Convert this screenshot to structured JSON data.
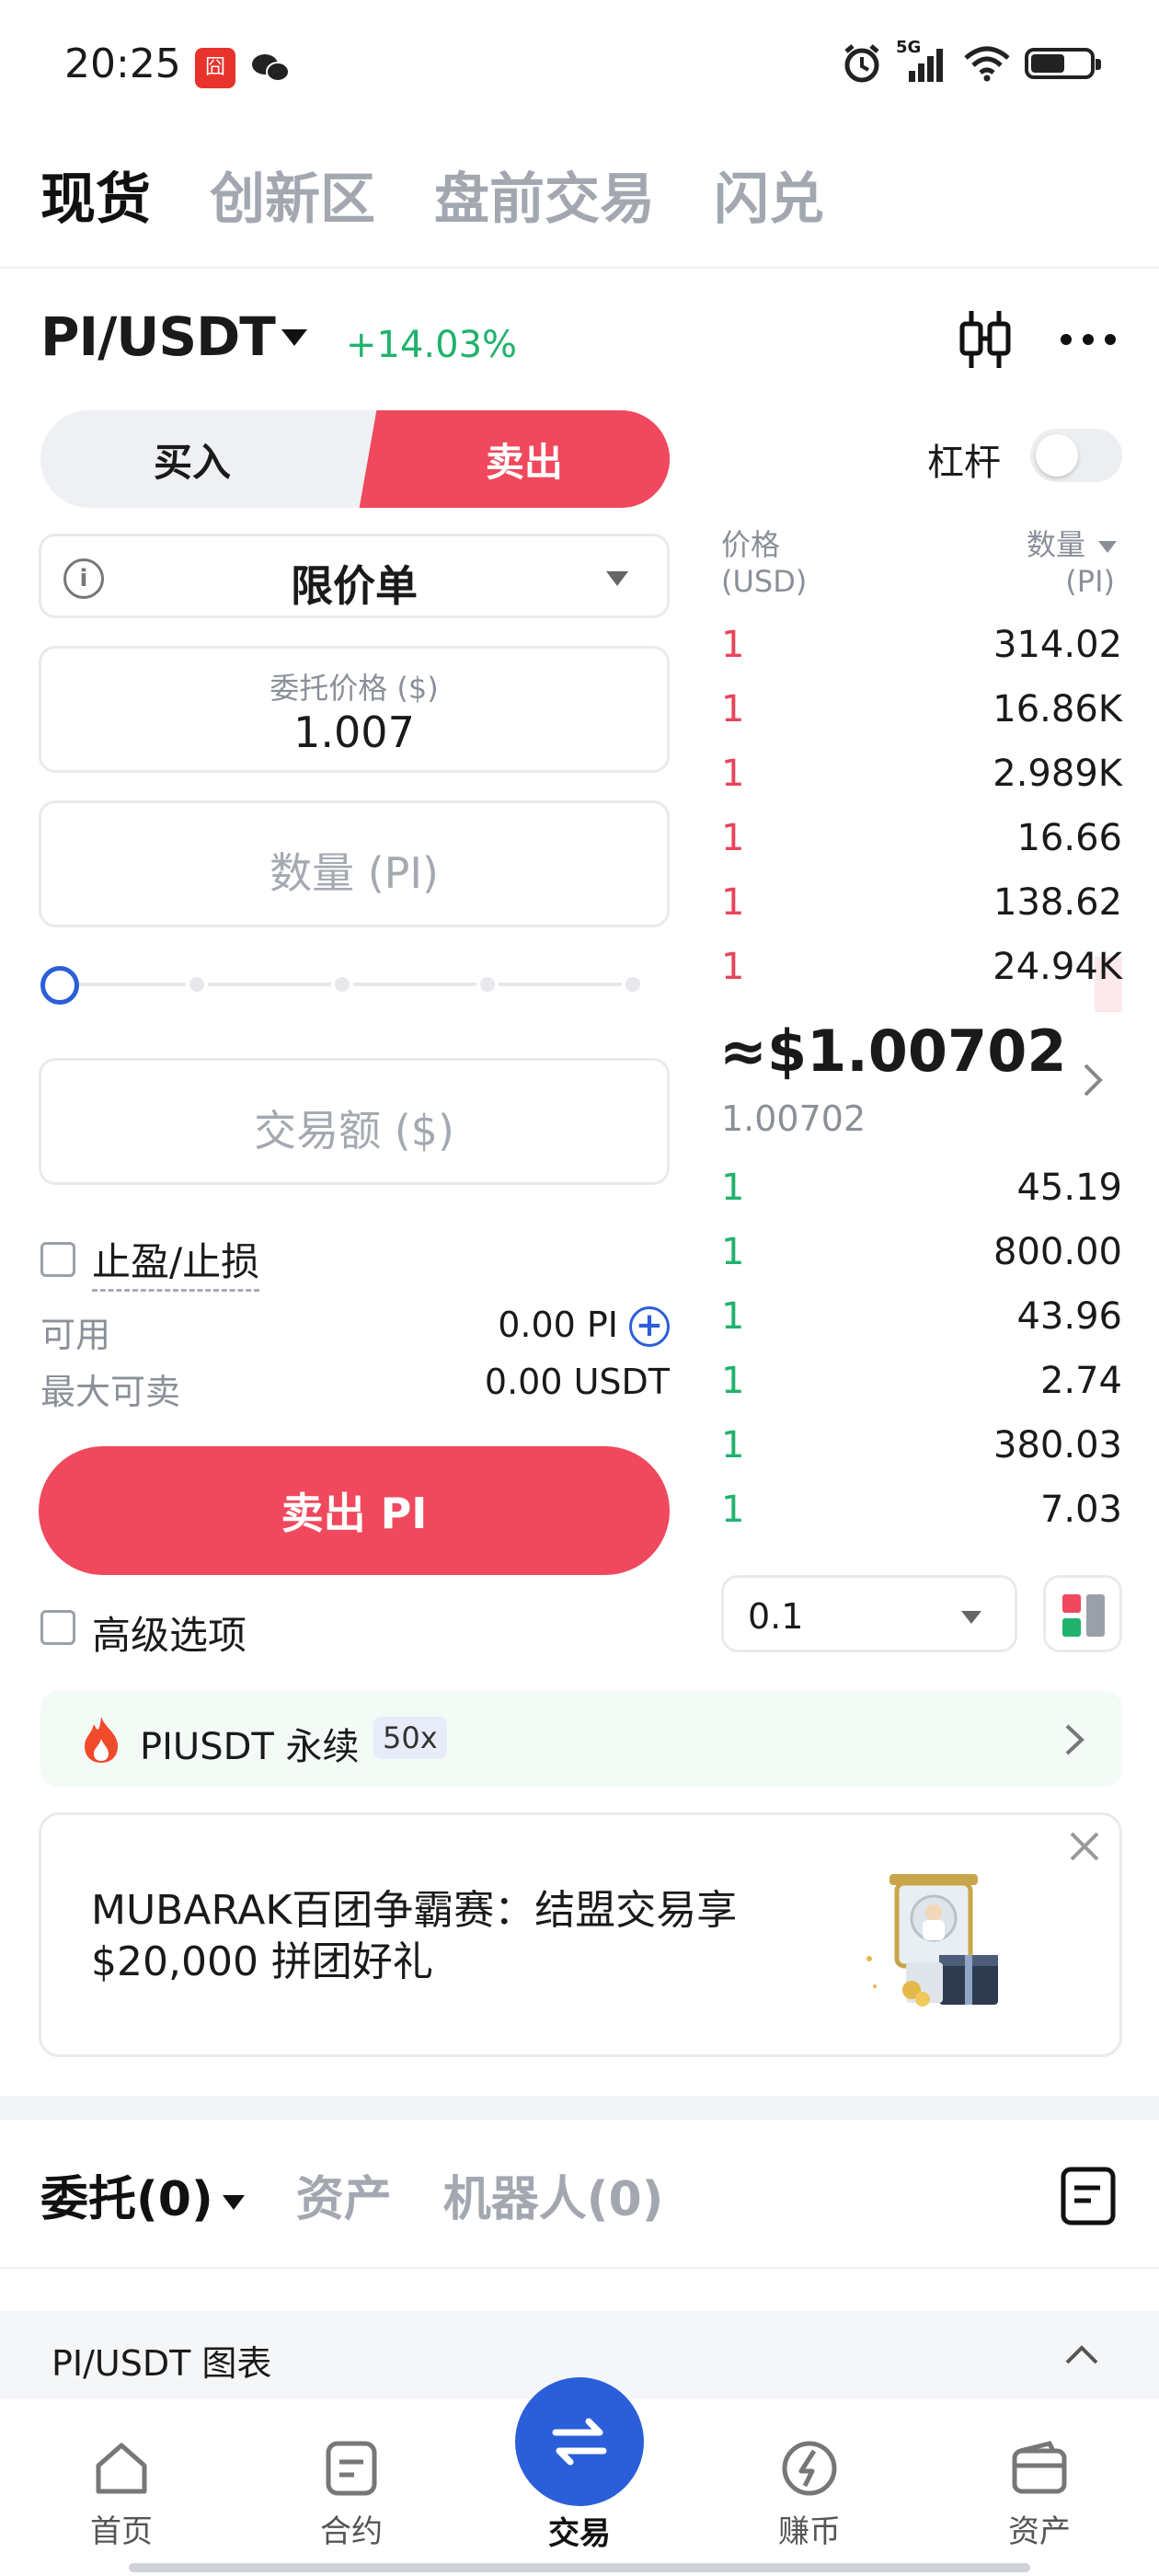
{
  "status_bar": {
    "time": "20:25",
    "network": "5G"
  },
  "top_tabs": [
    {
      "label": "现货",
      "active": true
    },
    {
      "label": "创新区",
      "active": false
    },
    {
      "label": "盘前交易",
      "active": false
    },
    {
      "label": "闪兑",
      "active": false
    }
  ],
  "pair": {
    "name": "PI/USDT",
    "change": "+14.03%"
  },
  "trade": {
    "buy_label": "买入",
    "sell_label": "卖出",
    "leverage_label": "杠杆",
    "order_type": "限价单",
    "price_label": "委托价格 ($)",
    "price_value": "1.007",
    "qty_placeholder": "数量 (PI)",
    "amount_placeholder": "交易额 ($)",
    "tpsl_label": "止盈/止损",
    "available_label": "可用",
    "available_value": "0.00 PI",
    "max_sell_label": "最大可卖",
    "max_sell_value": "0.00 USDT",
    "submit_label": "卖出 PI",
    "advanced_label": "高级选项"
  },
  "order_book": {
    "price_header": "价格",
    "price_unit": "(USD)",
    "qty_header": "数量",
    "qty_unit": "(PI)",
    "asks": [
      {
        "price": "1",
        "qty": "314.02"
      },
      {
        "price": "1",
        "qty": "16.86K"
      },
      {
        "price": "1",
        "qty": "2.989K"
      },
      {
        "price": "1",
        "qty": "16.66"
      },
      {
        "price": "1",
        "qty": "138.62"
      },
      {
        "price": "1",
        "qty": "24.94K"
      }
    ],
    "mid_price": "≈$1.00702",
    "mid_sub": "1.00702",
    "bids": [
      {
        "price": "1",
        "qty": "45.19"
      },
      {
        "price": "1",
        "qty": "800.00"
      },
      {
        "price": "1",
        "qty": "43.96"
      },
      {
        "price": "1",
        "qty": "2.74"
      },
      {
        "price": "1",
        "qty": "380.03"
      },
      {
        "price": "1",
        "qty": "7.03"
      }
    ],
    "depth_step": "0.1"
  },
  "perp_banner": {
    "label": "PIUSDT 永续",
    "leverage": "50x"
  },
  "promo": {
    "text": "MUBARAK百团争霸赛：结盟交易享$20,000 拼团好礼"
  },
  "orders_tabs": [
    {
      "label": "委托(0)",
      "active": true
    },
    {
      "label": "资产",
      "active": false
    },
    {
      "label": "机器人(0)",
      "active": false
    }
  ],
  "chart_bar": {
    "label": "PI/USDT 图表"
  },
  "bottom_nav": {
    "home": "首页",
    "contract": "合约",
    "trade": "交易",
    "earn": "赚币",
    "assets": "资产"
  },
  "colors": {
    "sell": "#f0485c",
    "buy": "#20b26c",
    "accent": "#2b5fd9"
  }
}
